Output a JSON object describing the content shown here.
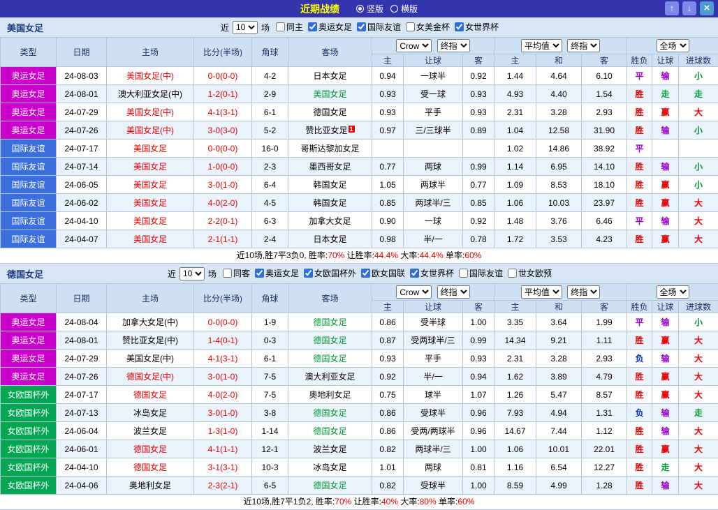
{
  "titlebar": {
    "title": "近期战绩",
    "layout_options": [
      {
        "label": "竖版",
        "selected": true
      },
      {
        "label": "横版",
        "selected": false
      }
    ],
    "buttons": {
      "up": "↑",
      "down": "↓",
      "close": "×"
    }
  },
  "table_headers": {
    "type": "类型",
    "date": "日期",
    "home": "主场",
    "score": "比分(半场)",
    "corner": "角球",
    "away": "客场",
    "hcp_home": "主",
    "hcp_line": "让球",
    "hcp_away": "客",
    "avg_home": "主",
    "avg_draw": "和",
    "avg_away": "客",
    "wdl": "胜负",
    "hcp_res": "让球",
    "goals": "进球数"
  },
  "team_colors": {
    "red": "#e60000",
    "green": "#009933",
    "black": "#000000"
  },
  "type_colors": {
    "奥运女足": "#cc00cc",
    "国际友谊": "#3a6edc",
    "女欧国杯外": "#00a651"
  },
  "result_colors": {
    "胜": "#e60000",
    "平": "#9900cc",
    "负": "#0033cc",
    "赢": "#e60000",
    "输": "#9900cc",
    "走": "#009933",
    "大": "#e60000",
    "小": "#009933"
  },
  "sections": [
    {
      "team": "美国女足",
      "filters": {
        "near": "近",
        "count": "10",
        "games": "场",
        "checkboxes": [
          {
            "label": "同主",
            "checked": false
          },
          {
            "label": "奥运女足",
            "checked": true
          },
          {
            "label": "国际友谊",
            "checked": true
          },
          {
            "label": "女美金杯",
            "checked": false
          },
          {
            "label": "女世界杯",
            "checked": true
          }
        ]
      },
      "dropdowns": {
        "odds_source": "Crow",
        "odds_time": "终指",
        "avg_source": "平均值",
        "avg_time": "终指",
        "scope": "全场"
      },
      "rows": [
        {
          "type": "奥运女足",
          "date": "24-08-03",
          "home": "美国女足(中)",
          "hc": "red",
          "score": "0-0(0-0)",
          "corner": "4-2",
          "away": "日本女足",
          "ac": "black",
          "o1": "0.94",
          "line": "一球半",
          "o2": "0.92",
          "a1": "1.44",
          "a2": "4.64",
          "a3": "6.10",
          "wdl": "平",
          "hr": "输",
          "gr": "小"
        },
        {
          "type": "奥运女足",
          "date": "24-08-01",
          "home": "澳大利亚女足(中)",
          "hc": "black",
          "score": "1-2(0-1)",
          "corner": "2-9",
          "away": "美国女足",
          "ac": "green",
          "o1": "0.93",
          "line": "受一球",
          "o2": "0.93",
          "a1": "4.93",
          "a2": "4.40",
          "a3": "1.54",
          "wdl": "胜",
          "hr": "走",
          "gr": "走"
        },
        {
          "type": "奥运女足",
          "date": "24-07-29",
          "home": "美国女足(中)",
          "hc": "red",
          "score": "4-1(3-1)",
          "corner": "6-1",
          "away": "德国女足",
          "ac": "black",
          "o1": "0.93",
          "line": "平手",
          "o2": "0.93",
          "a1": "2.31",
          "a2": "3.28",
          "a3": "2.93",
          "wdl": "胜",
          "hr": "赢",
          "gr": "大"
        },
        {
          "type": "奥运女足",
          "date": "24-07-26",
          "home": "美国女足(中)",
          "hc": "red",
          "score": "3-0(3-0)",
          "corner": "5-2",
          "away": "赞比亚女足",
          "ac": "black",
          "badge": "1",
          "o1": "0.97",
          "line": "三/三球半",
          "o2": "0.89",
          "a1": "1.04",
          "a2": "12.58",
          "a3": "31.90",
          "wdl": "胜",
          "hr": "输",
          "gr": "小"
        },
        {
          "type": "国际友谊",
          "date": "24-07-17",
          "home": "美国女足",
          "hc": "red",
          "score": "0-0(0-0)",
          "corner": "16-0",
          "away": "哥斯达黎加女足",
          "ac": "black",
          "o1": "",
          "line": "",
          "o2": "",
          "a1": "1.02",
          "a2": "14.86",
          "a3": "38.92",
          "wdl": "平",
          "hr": "",
          "gr": ""
        },
        {
          "type": "国际友谊",
          "date": "24-07-14",
          "home": "美国女足",
          "hc": "red",
          "score": "1-0(0-0)",
          "corner": "2-3",
          "away": "墨西哥女足",
          "ac": "black",
          "o1": "0.77",
          "line": "两球",
          "o2": "0.99",
          "a1": "1.14",
          "a2": "6.95",
          "a3": "14.10",
          "wdl": "胜",
          "hr": "输",
          "gr": "小"
        },
        {
          "type": "国际友谊",
          "date": "24-06-05",
          "home": "美国女足",
          "hc": "red",
          "score": "3-0(1-0)",
          "corner": "6-4",
          "away": "韩国女足",
          "ac": "black",
          "o1": "1.05",
          "line": "两球半",
          "o2": "0.77",
          "a1": "1.09",
          "a2": "8.53",
          "a3": "18.10",
          "wdl": "胜",
          "hr": "赢",
          "gr": "小"
        },
        {
          "type": "国际友谊",
          "date": "24-06-02",
          "home": "美国女足",
          "hc": "red",
          "score": "4-0(2-0)",
          "corner": "4-5",
          "away": "韩国女足",
          "ac": "black",
          "o1": "0.85",
          "line": "两球半/三",
          "o2": "0.85",
          "a1": "1.06",
          "a2": "10.03",
          "a3": "23.97",
          "wdl": "胜",
          "hr": "赢",
          "gr": "大"
        },
        {
          "type": "国际友谊",
          "date": "24-04-10",
          "home": "美国女足",
          "hc": "red",
          "score": "2-2(0-1)",
          "corner": "6-3",
          "away": "加拿大女足",
          "ac": "black",
          "o1": "0.90",
          "line": "一球",
          "o2": "0.92",
          "a1": "1.48",
          "a2": "3.76",
          "a3": "6.46",
          "wdl": "平",
          "hr": "输",
          "gr": "大"
        },
        {
          "type": "国际友谊",
          "date": "24-04-07",
          "home": "美国女足",
          "hc": "red",
          "score": "2-1(1-1)",
          "corner": "2-4",
          "away": "日本女足",
          "ac": "black",
          "o1": "0.98",
          "line": "半/一",
          "o2": "0.78",
          "a1": "1.72",
          "a2": "3.53",
          "a3": "4.23",
          "wdl": "胜",
          "hr": "赢",
          "gr": "大"
        }
      ],
      "summary": [
        {
          "t": "近10场,胜7平3负0, 胜率:",
          "c": "black"
        },
        {
          "t": "70%",
          "c": "red"
        },
        {
          "t": " 让胜率:",
          "c": "black"
        },
        {
          "t": "44.4%",
          "c": "red"
        },
        {
          "t": " 大率:",
          "c": "black"
        },
        {
          "t": "44.4%",
          "c": "red"
        },
        {
          "t": " 单率:",
          "c": "black"
        },
        {
          "t": "60%",
          "c": "red"
        }
      ]
    },
    {
      "team": "德国女足",
      "filters": {
        "near": "近",
        "count": "10",
        "games": "场",
        "checkboxes": [
          {
            "label": "同客",
            "checked": false
          },
          {
            "label": "奥运女足",
            "checked": true
          },
          {
            "label": "女欧国杯外",
            "checked": true
          },
          {
            "label": "欧女国联",
            "checked": true
          },
          {
            "label": "女世界杯",
            "checked": true
          },
          {
            "label": "国际友谊",
            "checked": false
          },
          {
            "label": "世女欧预",
            "checked": false
          }
        ]
      },
      "dropdowns": {
        "odds_source": "Crow",
        "odds_time": "终指",
        "avg_source": "平均值",
        "avg_time": "终指",
        "scope": "全场"
      },
      "rows": [
        {
          "type": "奥运女足",
          "date": "24-08-04",
          "home": "加拿大女足(中)",
          "hc": "black",
          "score": "0-0(0-0)",
          "corner": "1-9",
          "away": "德国女足",
          "ac": "green",
          "o1": "0.86",
          "line": "受半球",
          "o2": "1.00",
          "a1": "3.35",
          "a2": "3.64",
          "a3": "1.99",
          "wdl": "平",
          "hr": "输",
          "gr": "小"
        },
        {
          "type": "奥运女足",
          "date": "24-08-01",
          "home": "赞比亚女足(中)",
          "hc": "black",
          "score": "1-4(0-1)",
          "corner": "0-3",
          "away": "德国女足",
          "ac": "green",
          "o1": "0.87",
          "line": "受两球半/三",
          "o2": "0.99",
          "a1": "14.34",
          "a2": "9.21",
          "a3": "1.11",
          "wdl": "胜",
          "hr": "赢",
          "gr": "大"
        },
        {
          "type": "奥运女足",
          "date": "24-07-29",
          "home": "美国女足(中)",
          "hc": "black",
          "score": "4-1(3-1)",
          "corner": "6-1",
          "away": "德国女足",
          "ac": "green",
          "o1": "0.93",
          "line": "平手",
          "o2": "0.93",
          "a1": "2.31",
          "a2": "3.28",
          "a3": "2.93",
          "wdl": "负",
          "hr": "输",
          "gr": "大"
        },
        {
          "type": "奥运女足",
          "date": "24-07-26",
          "home": "德国女足(中)",
          "hc": "red",
          "score": "3-0(1-0)",
          "corner": "7-5",
          "away": "澳大利亚女足",
          "ac": "black",
          "o1": "0.92",
          "line": "半/一",
          "o2": "0.94",
          "a1": "1.62",
          "a2": "3.89",
          "a3": "4.79",
          "wdl": "胜",
          "hr": "赢",
          "gr": "大"
        },
        {
          "type": "女欧国杯外",
          "date": "24-07-17",
          "home": "德国女足",
          "hc": "red",
          "score": "4-0(2-0)",
          "corner": "7-5",
          "away": "奥地利女足",
          "ac": "black",
          "o1": "0.75",
          "line": "球半",
          "o2": "1.07",
          "a1": "1.26",
          "a2": "5.47",
          "a3": "8.57",
          "wdl": "胜",
          "hr": "赢",
          "gr": "大"
        },
        {
          "type": "女欧国杯外",
          "date": "24-07-13",
          "home": "冰岛女足",
          "hc": "black",
          "score": "3-0(1-0)",
          "corner": "3-8",
          "away": "德国女足",
          "ac": "green",
          "o1": "0.86",
          "line": "受球半",
          "o2": "0.96",
          "a1": "7.93",
          "a2": "4.94",
          "a3": "1.31",
          "wdl": "负",
          "hr": "输",
          "gr": "走"
        },
        {
          "type": "女欧国杯外",
          "date": "24-06-04",
          "home": "波兰女足",
          "hc": "black",
          "score": "1-3(1-0)",
          "corner": "1-14",
          "away": "德国女足",
          "ac": "green",
          "o1": "0.86",
          "line": "受两/两球半",
          "o2": "0.96",
          "a1": "14.67",
          "a2": "7.44",
          "a3": "1.12",
          "wdl": "胜",
          "hr": "输",
          "gr": "大"
        },
        {
          "type": "女欧国杯外",
          "date": "24-06-01",
          "home": "德国女足",
          "hc": "red",
          "score": "4-1(1-1)",
          "corner": "12-1",
          "away": "波兰女足",
          "ac": "black",
          "o1": "0.82",
          "line": "两球半/三",
          "o2": "1.00",
          "a1": "1.06",
          "a2": "10.01",
          "a3": "22.01",
          "wdl": "胜",
          "hr": "赢",
          "gr": "大"
        },
        {
          "type": "女欧国杯外",
          "date": "24-04-10",
          "home": "德国女足",
          "hc": "red",
          "score": "3-1(3-1)",
          "corner": "10-3",
          "away": "冰岛女足",
          "ac": "black",
          "o1": "1.01",
          "line": "两球",
          "o2": "0.81",
          "a1": "1.16",
          "a2": "6.54",
          "a3": "12.27",
          "wdl": "胜",
          "hr": "走",
          "gr": "大"
        },
        {
          "type": "女欧国杯外",
          "date": "24-04-06",
          "home": "奥地利女足",
          "hc": "black",
          "score": "2-3(2-1)",
          "corner": "6-5",
          "away": "德国女足",
          "ac": "green",
          "o1": "0.82",
          "line": "受球半",
          "o2": "1.00",
          "a1": "8.59",
          "a2": "4.99",
          "a3": "1.28",
          "wdl": "胜",
          "hr": "输",
          "gr": "大"
        }
      ],
      "summary": [
        {
          "t": "近10场,胜7平1负2, 胜率:",
          "c": "black"
        },
        {
          "t": "70%",
          "c": "red"
        },
        {
          "t": " 让胜率:",
          "c": "black"
        },
        {
          "t": "40%",
          "c": "red"
        },
        {
          "t": " 大率:",
          "c": "black"
        },
        {
          "t": "80%",
          "c": "red"
        },
        {
          "t": " 单率:",
          "c": "black"
        },
        {
          "t": "60%",
          "c": "red"
        }
      ]
    }
  ]
}
